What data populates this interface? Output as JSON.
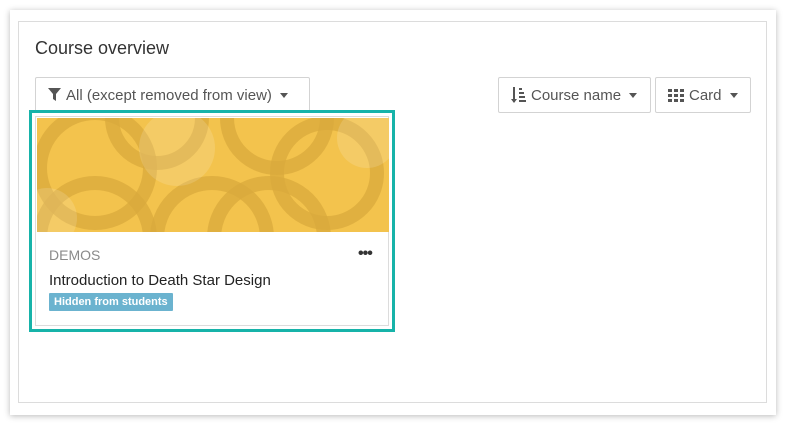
{
  "block": {
    "title": "Course overview"
  },
  "controls": {
    "filter": {
      "label": "All (except removed from view)",
      "icon": "filter-icon"
    },
    "sort": {
      "label": "Course name",
      "icon": "sort-alpha-icon"
    },
    "view": {
      "label": "Card",
      "icon": "grid-icon"
    }
  },
  "course": {
    "category": "DEMOS",
    "name": "Introduction to Death Star Design",
    "badge": "Hidden from students",
    "menu_icon": "more-options-icon"
  },
  "colors": {
    "highlight": "#17b3a9",
    "badge": "#6bb3cf",
    "card_pattern": "#f3c34d"
  }
}
